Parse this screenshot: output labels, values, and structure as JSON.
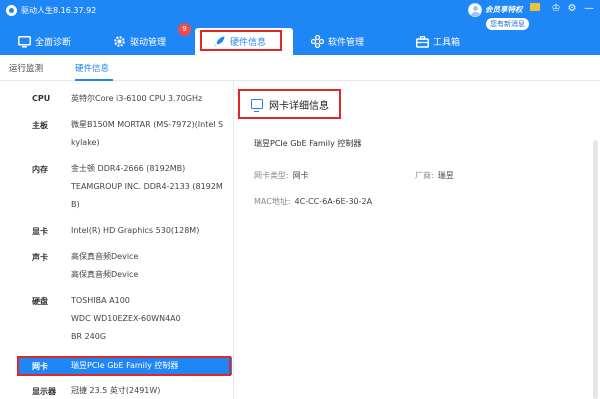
{
  "app": {
    "title": "驱动人生8.16.37.92"
  },
  "user": {
    "member_label": "会员享特权",
    "message_badge": "您有新消息"
  },
  "window_buttons": {
    "skin": "♔",
    "settings": "⚙",
    "minimize": "—"
  },
  "nav": {
    "items": [
      {
        "label": "全面诊断",
        "icon": "monitor-icon"
      },
      {
        "label": "驱动管理",
        "icon": "gear-icon"
      },
      {
        "label": "硬件信息",
        "icon": "rocket-icon"
      },
      {
        "label": "软件管理",
        "icon": "apps-icon"
      },
      {
        "label": "工具箱",
        "icon": "toolbox-icon"
      }
    ],
    "badge_count": "9",
    "active_index": 2
  },
  "subtabs": {
    "items": [
      "运行监测",
      "硬件信息"
    ],
    "active_index": 1
  },
  "hardware": [
    {
      "label": "CPU",
      "lines": [
        "英特尔Core i3-6100 CPU 3.70GHz"
      ]
    },
    {
      "label": "主板",
      "lines": [
        "微星B150M MORTAR (MS-7972)(Intel S",
        "kylake)"
      ]
    },
    {
      "label": "内存",
      "lines": [
        "金士顿 DDR4-2666 (8192MB)",
        "TEAMGROUP INC. DDR4-2133 (8192M",
        "B)"
      ]
    },
    {
      "label": "显卡",
      "lines": [
        "Intel(R) HD Graphics 530(128M)"
      ]
    },
    {
      "label": "声卡",
      "lines": [
        "高保真音频Device",
        "高保真音频Device"
      ]
    },
    {
      "label": "硬盘",
      "lines": [
        "TOSHIBA A100",
        "WDC WD10EZEX-60WN4A0",
        "BR 240G"
      ]
    },
    {
      "label": "网卡",
      "lines": [
        "瑞昱PCIe GbE Family 控制器"
      ],
      "selected": true
    },
    {
      "label": "显示器",
      "lines": [
        "冠捷 23.5 英寸(2491W)"
      ]
    }
  ],
  "detail": {
    "section_title": "网卡详细信息",
    "device_name": "瑞昱PCIe GbE Family 控制器",
    "type_label": "网卡类型:",
    "type_value": "网卡",
    "vendor_label": "厂商:",
    "vendor_value": "瑞昱",
    "mac_label": "MAC地址:",
    "mac_value": "4C-CC-6A-6E-30-2A"
  },
  "colors": {
    "accent": "#1f86f5",
    "highlight_border": "#e22525",
    "badge": "#f24b4b"
  }
}
